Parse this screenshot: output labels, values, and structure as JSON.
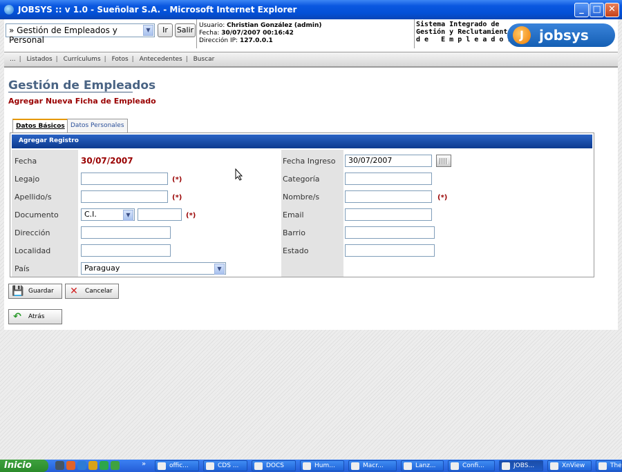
{
  "window": {
    "title": "JOBSYS :: v 1.0 - Sueñolar S.A. - Microsoft Internet Explorer"
  },
  "header": {
    "nav_select_value": "» Gestión de Empleados y Personal",
    "go_button": "Ir",
    "logout_button": "Salir",
    "user_label": "Usuario:",
    "user_value": "Christian González (admin)",
    "date_label": "Fecha:",
    "date_value": "30/07/2007 00:16:42",
    "ip_label": "Dirección IP:",
    "ip_value": "127.0.0.1",
    "system_line1": "Sistema Integrado de",
    "system_line2": "Gestión y Reclutamiento",
    "system_line3": "d e   E m p l e a d o s",
    "logo_text": "jobsys"
  },
  "menu": {
    "items": [
      "...",
      "Listados",
      "Currículums",
      "Fotos",
      "Antecedentes",
      "Buscar"
    ]
  },
  "page": {
    "title": "Gestión de Empleados",
    "subtitle": "Agregar Nueva Ficha de Empleado",
    "tabs": [
      {
        "label": "Datos Básicos",
        "active": true
      },
      {
        "label": "Datos Personales",
        "active": false
      }
    ]
  },
  "form": {
    "header": "Agregar Registro",
    "required_mark": "(*)",
    "left": {
      "fecha_label": "Fecha",
      "fecha_value": "30/07/2007",
      "legajo_label": "Legajo",
      "apellido_label": "Apellido/s",
      "documento_label": "Documento",
      "documento_type": "C.I.",
      "direccion_label": "Dirección",
      "localidad_label": "Localidad",
      "pais_label": "País",
      "pais_value": "Paraguay"
    },
    "right": {
      "fecha_ingreso_label": "Fecha Ingreso",
      "fecha_ingreso_value": "30/07/2007",
      "categoria_label": "Categoría",
      "nombre_label": "Nombre/s",
      "email_label": "Email",
      "barrio_label": "Barrio",
      "estado_label": "Estado"
    }
  },
  "actions": {
    "save": "Guardar",
    "cancel": "Cancelar",
    "back": "Atrás"
  },
  "taskbar": {
    "start": "Inicio",
    "chevron": "»",
    "tasks": [
      "offic...",
      "CDS ...",
      "DOCS",
      "Hum...",
      "Macr...",
      "Lanz...",
      "Confi...",
      "JOBS...",
      "XnView",
      "The"
    ]
  }
}
